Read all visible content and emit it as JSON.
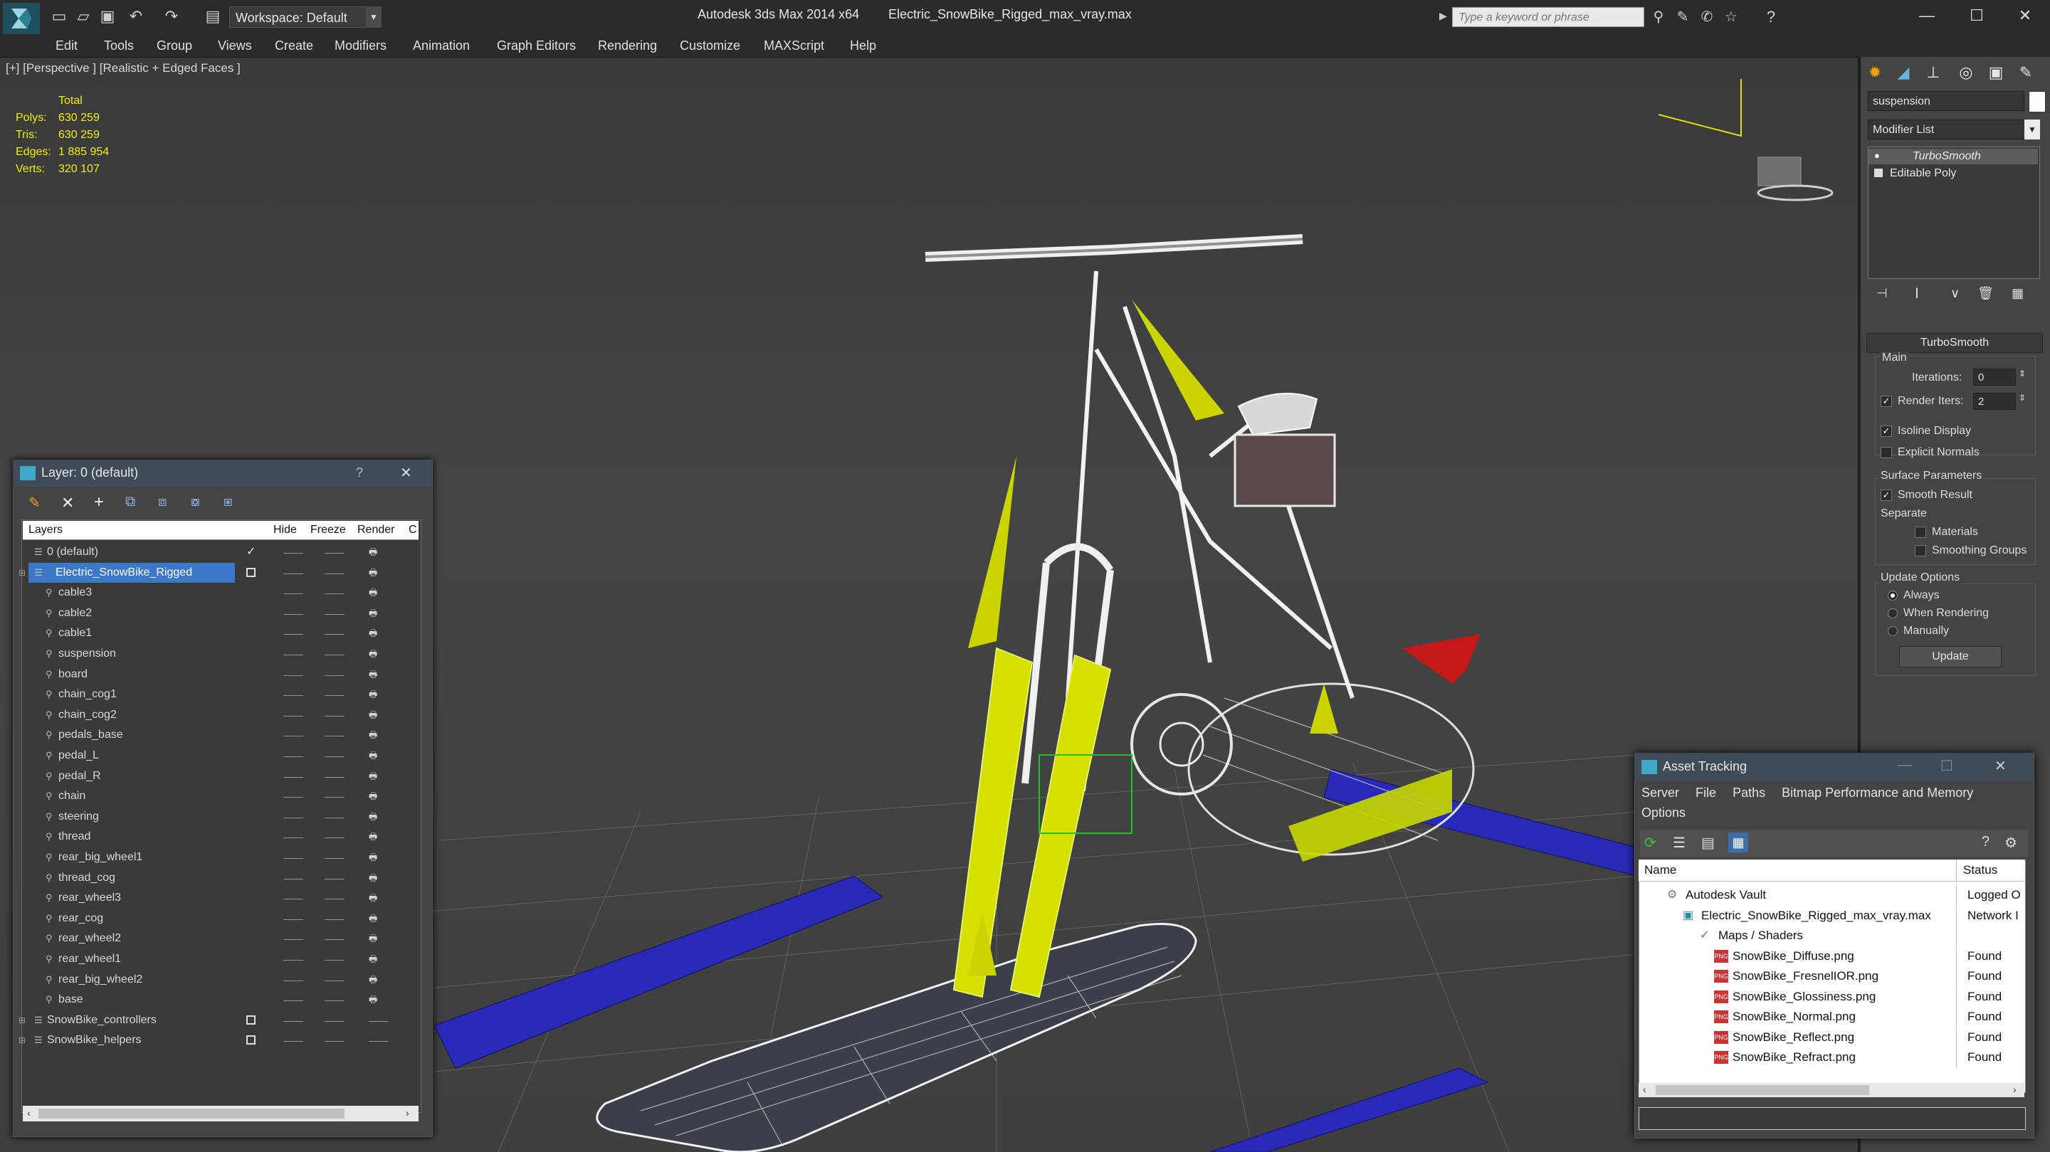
{
  "titlebar": {
    "workspace": "Workspace: Default",
    "app_title": "Autodesk 3ds Max  2014 x64",
    "file_title": "Electric_SnowBike_Rigged_max_vray.max",
    "search_placeholder": "Type a keyword or phrase",
    "help_icon": "?"
  },
  "menu": [
    "Edit",
    "Tools",
    "Group",
    "Views",
    "Create",
    "Modifiers",
    "Animation",
    "Graph Editors",
    "Rendering",
    "Customize",
    "MAXScript",
    "Help"
  ],
  "viewport": {
    "label": "[+] [Perspective ] [Realistic + Edged Faces ]",
    "stats": {
      "header": "Total",
      "rows": [
        {
          "label": "Polys:",
          "value": "630 259"
        },
        {
          "label": "Tris:",
          "value": "630 259"
        },
        {
          "label": "Edges:",
          "value": "1 885 954"
        },
        {
          "label": "Verts:",
          "value": "320 107"
        }
      ]
    }
  },
  "command_panel": {
    "object_name": "suspension",
    "modifier_list": "Modifier List",
    "stack": [
      "TurboSmooth",
      "Editable Poly"
    ],
    "rollout_title": "TurboSmooth",
    "main_group": "Main",
    "iterations_label": "Iterations:",
    "iterations_value": "0",
    "render_iters_label": "Render Iters:",
    "render_iters_value": "2",
    "isoline": "Isoline Display",
    "explicit_normals": "Explicit Normals",
    "surface_params": "Surface Parameters",
    "smooth_result": "Smooth Result",
    "separate": "Separate",
    "materials": "Materials",
    "smoothing_groups": "Smoothing Groups",
    "update_options": "Update Options",
    "always": "Always",
    "when_rendering": "When Rendering",
    "manually": "Manually",
    "update_button": "Update"
  },
  "layer_dialog": {
    "title": "Layer: 0 (default)",
    "help": "?",
    "columns": {
      "layers": "Layers",
      "hide": "Hide",
      "freeze": "Freeze",
      "render": "Render",
      "c": "C"
    },
    "rows": [
      {
        "name": "0 (default)",
        "level": 1,
        "check": true,
        "box": false
      },
      {
        "name": "Electric_SnowBike_Rigged",
        "level": 1,
        "check": false,
        "box": true,
        "selected": true
      },
      {
        "name": "cable3",
        "level": 2
      },
      {
        "name": "cable2",
        "level": 2
      },
      {
        "name": "cable1",
        "level": 2
      },
      {
        "name": "suspension",
        "level": 2
      },
      {
        "name": "board",
        "level": 2
      },
      {
        "name": "chain_cog1",
        "level": 2
      },
      {
        "name": "chain_cog2",
        "level": 2
      },
      {
        "name": "pedals_base",
        "level": 2
      },
      {
        "name": "pedal_L",
        "level": 2
      },
      {
        "name": "pedal_R",
        "level": 2
      },
      {
        "name": "chain",
        "level": 2
      },
      {
        "name": "steering",
        "level": 2
      },
      {
        "name": "thread",
        "level": 2
      },
      {
        "name": "rear_big_wheel1",
        "level": 2
      },
      {
        "name": "thread_cog",
        "level": 2
      },
      {
        "name": "rear_wheel3",
        "level": 2
      },
      {
        "name": "rear_cog",
        "level": 2
      },
      {
        "name": "rear_wheel2",
        "level": 2
      },
      {
        "name": "rear_wheel1",
        "level": 2
      },
      {
        "name": "rear_big_wheel2",
        "level": 2
      },
      {
        "name": "base",
        "level": 2
      },
      {
        "name": "SnowBike_controllers",
        "level": 1,
        "box": true
      },
      {
        "name": "SnowBike_helpers",
        "level": 1,
        "box": true
      }
    ]
  },
  "asset_tracking": {
    "title": "Asset Tracking",
    "menu1": [
      "Server",
      "File",
      "Paths",
      "Bitmap Performance and Memory"
    ],
    "menu2": [
      "Options"
    ],
    "col_name": "Name",
    "col_status": "Status",
    "rows": [
      {
        "name": "Autodesk Vault",
        "status": "Logged O",
        "indent": 1,
        "icon": "vault"
      },
      {
        "name": "Electric_SnowBike_Rigged_max_vray.max",
        "status": "Network I",
        "indent": 2,
        "icon": "max"
      },
      {
        "name": "Maps / Shaders",
        "status": "",
        "indent": 3,
        "icon": "maps"
      },
      {
        "name": "SnowBike_Diffuse.png",
        "status": "Found",
        "indent": 4,
        "icon": "png"
      },
      {
        "name": "SnowBike_FresnelIOR.png",
        "status": "Found",
        "indent": 4,
        "icon": "png"
      },
      {
        "name": "SnowBike_Glossiness.png",
        "status": "Found",
        "indent": 4,
        "icon": "png"
      },
      {
        "name": "SnowBike_Normal.png",
        "status": "Found",
        "indent": 4,
        "icon": "png"
      },
      {
        "name": "SnowBike_Reflect.png",
        "status": "Found",
        "indent": 4,
        "icon": "png"
      },
      {
        "name": "SnowBike_Refract.png",
        "status": "Found",
        "indent": 4,
        "icon": "png"
      }
    ]
  },
  "colors": {
    "accent": "#1e6fb3",
    "stats": "#f0f000",
    "wire_yellow": "#d4e000",
    "floor_blue": "#2a2ab8"
  }
}
